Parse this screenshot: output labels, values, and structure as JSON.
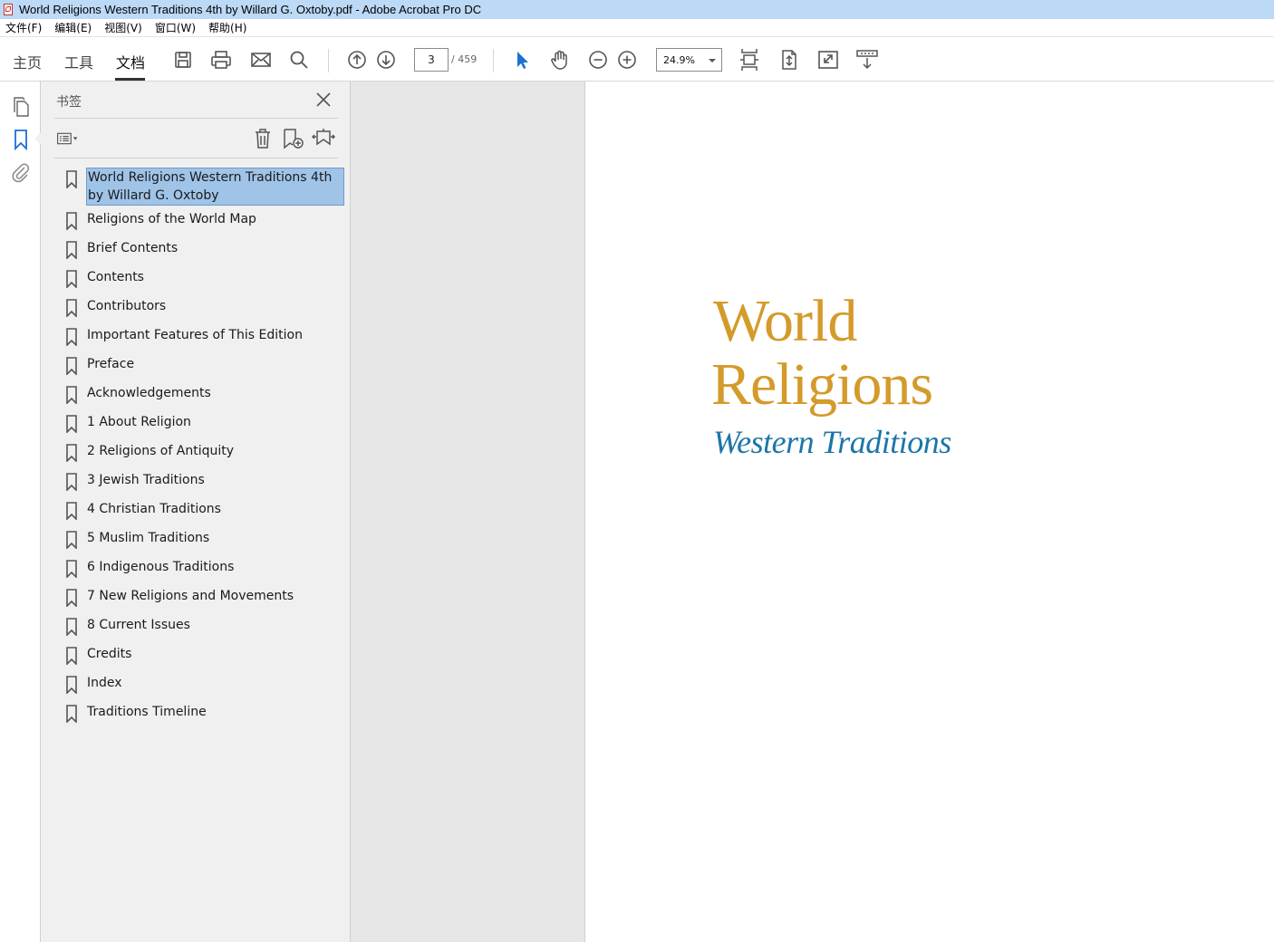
{
  "window": {
    "title": "World Religions Western Traditions 4th by Willard G. Oxtoby.pdf - Adobe Acrobat Pro DC"
  },
  "menu": [
    "文件(F)",
    "编辑(E)",
    "视图(V)",
    "窗口(W)",
    "帮助(H)"
  ],
  "toolbar": {
    "tabs": [
      "主页",
      "工具",
      "文档"
    ],
    "active_tab": "文档",
    "page_current": "3",
    "page_total": "/ 459",
    "zoom": "24.9%",
    "icons": [
      "save-icon",
      "print-icon",
      "email-icon",
      "search-icon",
      "prev-page-icon",
      "next-page-icon",
      "select-cursor-icon",
      "hand-icon",
      "zoom-out-icon",
      "zoom-in-icon",
      "fit-page-icon",
      "rotate-page-icon",
      "full-screen-icon",
      "read-mode-icon"
    ]
  },
  "rail": {
    "icons": [
      "page-thumbnails-icon",
      "bookmarks-icon",
      "attachments-icon"
    ],
    "active": "bookmarks-icon"
  },
  "bookmarks_panel": {
    "title": "书签",
    "items": [
      "World Religions Western Traditions 4th by Willard G. Oxtoby",
      "Religions of the World Map",
      "Brief Contents",
      "Contents",
      "Contributors",
      "Important Features of This Edition",
      "Preface",
      "Acknowledgements",
      "1 About Religion",
      "2 Religions of Antiquity",
      "3 Jewish Traditions",
      "4 Christian Traditions",
      "5 Muslim Traditions",
      "6 Indigenous Traditions",
      "7 New Religions and Movements",
      "8 Current Issues",
      "Credits",
      "Index",
      "Traditions Timeline"
    ],
    "selected_index": 0
  },
  "document": {
    "title_line1": "World",
    "title_line2": "Religions",
    "subtitle": "Western Traditions",
    "title_color": "#d49a2a",
    "subtitle_color": "#1b76a8"
  }
}
